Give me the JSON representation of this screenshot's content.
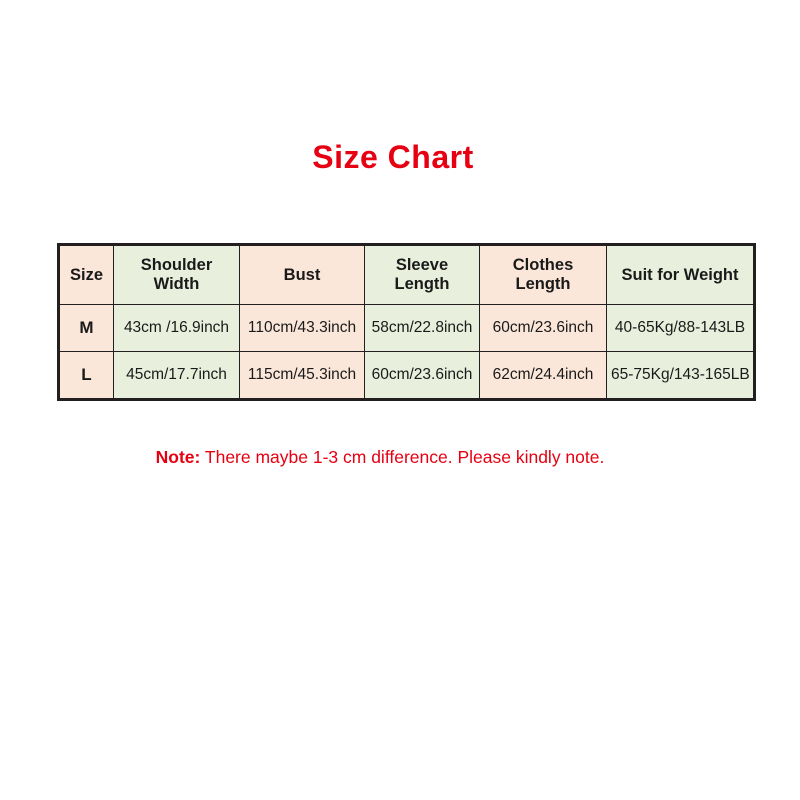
{
  "title": "Size Chart",
  "colors": {
    "title_red": "#e60012",
    "note_red": "#e60012",
    "peach": "#fbe7da",
    "green": "#e8f0dd",
    "border": "#231f20",
    "text": "#1a1a1a",
    "background": "#ffffff"
  },
  "note": {
    "label": "Note:",
    "body": "There maybe 1-3 cm difference. Please kindly note."
  },
  "chart_data": {
    "type": "table",
    "title": "Size Chart",
    "columns": [
      "Size",
      "Shoulder Width",
      "Bust",
      "Sleeve Length",
      "Clothes Length",
      "Suit for Weight"
    ],
    "column_tints": [
      "peach",
      "green",
      "peach",
      "green",
      "peach",
      "green"
    ],
    "rows": [
      {
        "size": "M",
        "shoulder_width": "43cm /16.9inch",
        "bust": "110cm/43.3inch",
        "sleeve_length": "58cm/22.8inch",
        "clothes_length": "60cm/23.6inch",
        "suit_for_weight": "40-65Kg/88-143LB"
      },
      {
        "size": "L",
        "shoulder_width": "45cm/17.7inch",
        "bust": "115cm/45.3inch",
        "sleeve_length": "60cm/23.6inch",
        "clothes_length": "62cm/24.4inch",
        "suit_for_weight": "65-75Kg/143-165LB"
      }
    ]
  },
  "headers": {
    "size": "Size",
    "shoulder_width_line1": "Shoulder",
    "shoulder_width_line2": "Width",
    "bust": "Bust",
    "sleeve_length_line1": "Sleeve",
    "sleeve_length_line2": "Length",
    "clothes_length_line1": "Clothes",
    "clothes_length_line2": "Length",
    "suit_for_weight": "Suit for Weight"
  }
}
